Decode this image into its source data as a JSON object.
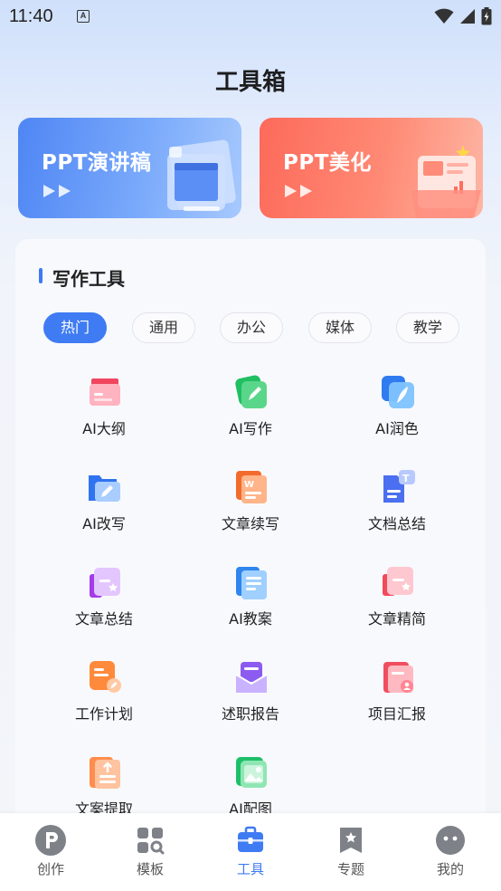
{
  "status": {
    "time": "11:40",
    "a_badge": "A"
  },
  "page": {
    "title": "工具箱"
  },
  "banners": [
    {
      "label": "PPT演讲稿",
      "color": "#5a8ef5"
    },
    {
      "label": "PPT美化",
      "color": "#fd6e5d"
    }
  ],
  "section": {
    "title": "写作工具",
    "tabs": [
      "热门",
      "通用",
      "办公",
      "媒体",
      "教学"
    ],
    "active_tab": "热门"
  },
  "tools": [
    {
      "label": "AI大纲",
      "icon": "outline-icon"
    },
    {
      "label": "AI写作",
      "icon": "pen-writing-icon"
    },
    {
      "label": "AI润色",
      "icon": "feather-polish-icon"
    },
    {
      "label": "AI改写",
      "icon": "folder-edit-icon"
    },
    {
      "label": "文章续写",
      "icon": "word-continue-icon"
    },
    {
      "label": "文档总结",
      "icon": "doc-summary-icon"
    },
    {
      "label": "文章总结",
      "icon": "article-summary-icon"
    },
    {
      "label": "AI教案",
      "icon": "lesson-plan-icon"
    },
    {
      "label": "文章精简",
      "icon": "article-simplify-icon"
    },
    {
      "label": "工作计划",
      "icon": "work-plan-icon"
    },
    {
      "label": "述职报告",
      "icon": "report-envelope-icon"
    },
    {
      "label": "项目汇报",
      "icon": "project-report-icon"
    },
    {
      "label": "文案提取",
      "icon": "copy-extract-icon"
    },
    {
      "label": "AI配图",
      "icon": "image-icon"
    }
  ],
  "nav": [
    {
      "label": "创作",
      "icon": "create-p-icon"
    },
    {
      "label": "模板",
      "icon": "template-grid-icon"
    },
    {
      "label": "工具",
      "icon": "toolbox-icon",
      "active": true
    },
    {
      "label": "专题",
      "icon": "topic-star-icon"
    },
    {
      "label": "我的",
      "icon": "profile-face-icon"
    }
  ],
  "colors": {
    "accent": "#3f7bf3",
    "nav_inactive": "#8e9096"
  }
}
